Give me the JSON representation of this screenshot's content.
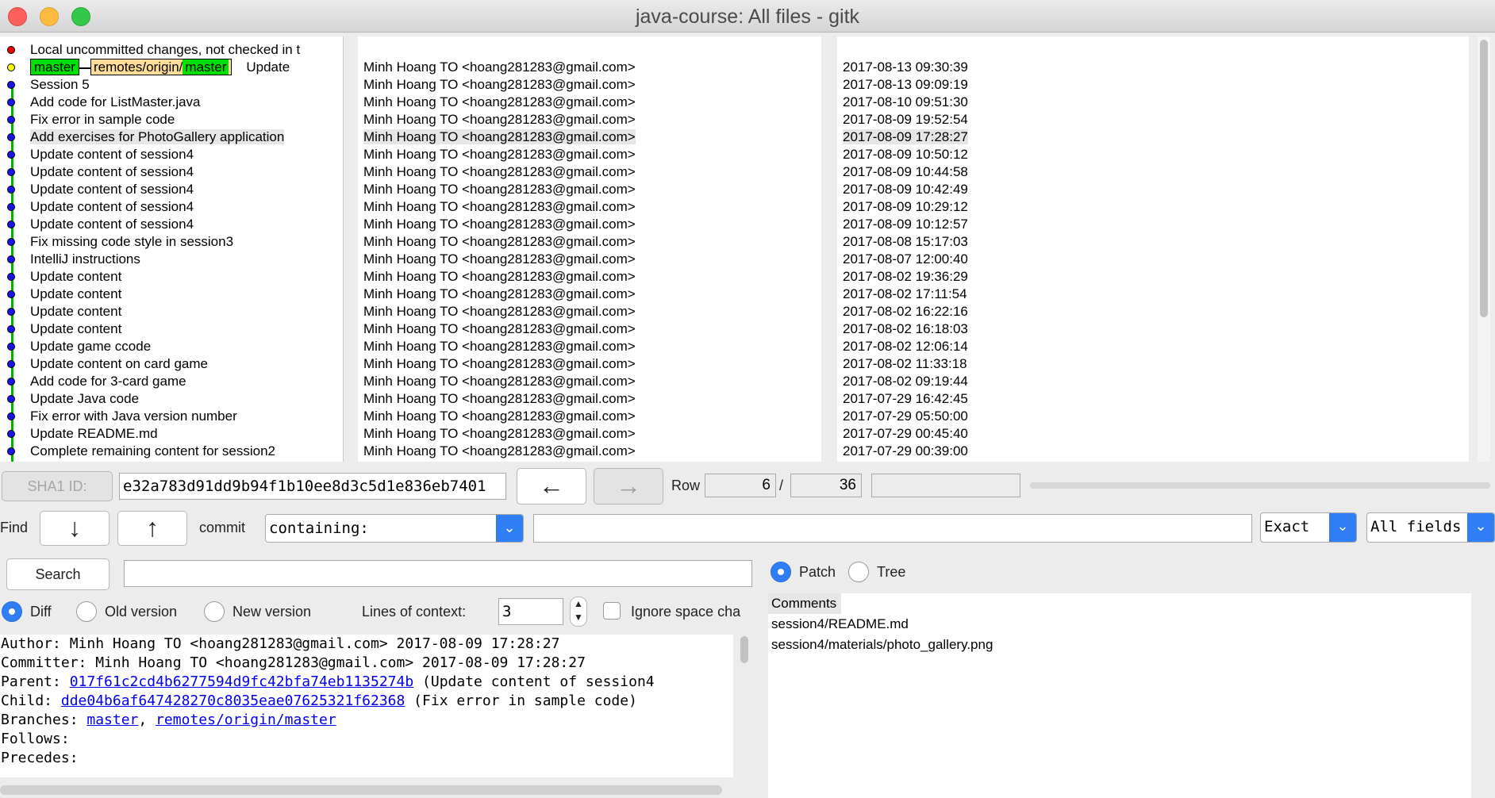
{
  "window": {
    "title": "java-course: All files - gitk"
  },
  "commits": [
    {
      "msg": "Local uncommitted changes, not checked in t",
      "author": "",
      "date": "",
      "dot": "red"
    },
    {
      "msg": "Update",
      "author": "Minh Hoang TO <hoang281283@gmail.com>",
      "date": "2017-08-13 09:30:39",
      "dot": "yellow",
      "refs": true
    },
    {
      "msg": "Session 5",
      "author": "Minh Hoang TO <hoang281283@gmail.com>",
      "date": "2017-08-13 09:09:19",
      "dot": "blue"
    },
    {
      "msg": "Add code for ListMaster.java",
      "author": "Minh Hoang TO <hoang281283@gmail.com>",
      "date": "2017-08-10 09:51:30",
      "dot": "blue"
    },
    {
      "msg": "Fix error in sample code",
      "author": "Minh Hoang TO <hoang281283@gmail.com>",
      "date": "2017-08-09 19:52:54",
      "dot": "blue"
    },
    {
      "msg": "Add exercises for PhotoGallery application",
      "author": "Minh Hoang TO <hoang281283@gmail.com>",
      "date": "2017-08-09 17:28:27",
      "dot": "blue",
      "selected": true
    },
    {
      "msg": "Update content of session4",
      "author": "Minh Hoang TO <hoang281283@gmail.com>",
      "date": "2017-08-09 10:50:12",
      "dot": "blue"
    },
    {
      "msg": "Update content of session4",
      "author": "Minh Hoang TO <hoang281283@gmail.com>",
      "date": "2017-08-09 10:44:58",
      "dot": "blue"
    },
    {
      "msg": "Update content of session4",
      "author": "Minh Hoang TO <hoang281283@gmail.com>",
      "date": "2017-08-09 10:42:49",
      "dot": "blue"
    },
    {
      "msg": "Update content of session4",
      "author": "Minh Hoang TO <hoang281283@gmail.com>",
      "date": "2017-08-09 10:29:12",
      "dot": "blue"
    },
    {
      "msg": "Update content of session4",
      "author": "Minh Hoang TO <hoang281283@gmail.com>",
      "date": "2017-08-09 10:12:57",
      "dot": "blue"
    },
    {
      "msg": "Fix missing code style in session3",
      "author": "Minh Hoang TO <hoang281283@gmail.com>",
      "date": "2017-08-08 15:17:03",
      "dot": "blue"
    },
    {
      "msg": "IntelliJ instructions",
      "author": "Minh Hoang TO <hoang281283@gmail.com>",
      "date": "2017-08-07 12:00:40",
      "dot": "blue"
    },
    {
      "msg": "Update content",
      "author": "Minh Hoang TO <hoang281283@gmail.com>",
      "date": "2017-08-02 19:36:29",
      "dot": "blue"
    },
    {
      "msg": "Update content",
      "author": "Minh Hoang TO <hoang281283@gmail.com>",
      "date": "2017-08-02 17:11:54",
      "dot": "blue"
    },
    {
      "msg": "Update content",
      "author": "Minh Hoang TO <hoang281283@gmail.com>",
      "date": "2017-08-02 16:22:16",
      "dot": "blue"
    },
    {
      "msg": "Update content",
      "author": "Minh Hoang TO <hoang281283@gmail.com>",
      "date": "2017-08-02 16:18:03",
      "dot": "blue"
    },
    {
      "msg": "Update game ccode",
      "author": "Minh Hoang TO <hoang281283@gmail.com>",
      "date": "2017-08-02 12:06:14",
      "dot": "blue"
    },
    {
      "msg": "Update content on card game",
      "author": "Minh Hoang TO <hoang281283@gmail.com>",
      "date": "2017-08-02 11:33:18",
      "dot": "blue"
    },
    {
      "msg": "Add code for 3-card game",
      "author": "Minh Hoang TO <hoang281283@gmail.com>",
      "date": "2017-08-02 09:19:44",
      "dot": "blue"
    },
    {
      "msg": "Update Java code",
      "author": "Minh Hoang TO <hoang281283@gmail.com>",
      "date": "2017-07-29 16:42:45",
      "dot": "blue"
    },
    {
      "msg": "Fix error with Java version number",
      "author": "Minh Hoang TO <hoang281283@gmail.com>",
      "date": "2017-07-29 05:50:00",
      "dot": "blue"
    },
    {
      "msg": "Update README.md",
      "author": "Minh Hoang TO <hoang281283@gmail.com>",
      "date": "2017-07-29 00:45:40",
      "dot": "blue"
    },
    {
      "msg": "Complete remaining content for session2",
      "author": "Minh Hoang TO <hoang281283@gmail.com>",
      "date": "2017-07-29 00:39:00",
      "dot": "blue"
    }
  ],
  "refs": {
    "local": "master",
    "remote_prefix": "remotes/origin/",
    "remote_branch": "master"
  },
  "sha": {
    "label": "SHA1 ID:",
    "value": "e32a783d91dd9b94f1b10ee8d3c5d1e836eb7401"
  },
  "nav": {
    "back_glyph": "←",
    "forward_glyph": "→",
    "row_label": "Row",
    "row_current": "6",
    "row_sep": "/",
    "row_total": "36"
  },
  "find": {
    "label": "Find",
    "down_glyph": "↓",
    "up_glyph": "↑",
    "commit_label": "commit",
    "mode": "containing:",
    "query": "",
    "match": "Exact",
    "fields": "All fields"
  },
  "search": {
    "button": "Search",
    "value": ""
  },
  "view": {
    "patch": "Patch",
    "tree": "Tree",
    "selected": "Patch"
  },
  "diff_opts": {
    "diff": "Diff",
    "old": "Old version",
    "new": "New version",
    "context_label": "Lines of context:",
    "context_value": "3",
    "ignore_space": "Ignore space cha"
  },
  "details": {
    "author": "Author: Minh Hoang TO <hoang281283@gmail.com>  2017-08-09 17:28:27",
    "committer": "Committer: Minh Hoang TO <hoang281283@gmail.com>  2017-08-09 17:28:27",
    "parent_label": "Parent: ",
    "parent_sha": "017f61c2cd4b6277594d9fc42bfa74eb1135274b",
    "parent_desc": " (Update content of session4",
    "child_label": "Child:  ",
    "child_sha": "dde04b6af647428270c8035eae07625321f62368",
    "child_desc": " (Fix error in sample code)",
    "branches_label": "Branches: ",
    "branch1": "master",
    "branch_sep": ", ",
    "branch2": "remotes/origin/master",
    "follows": "Follows:",
    "precedes": "Precedes:"
  },
  "files": {
    "header": "Comments",
    "items": [
      "session4/README.md",
      "session4/materials/photo_gallery.png"
    ]
  },
  "colors": {
    "graph": "#00b400",
    "ref_local": "#00e000",
    "ref_remote": "#ffdd99",
    "accent": "#2f7ef5",
    "link": "#0000ee"
  }
}
